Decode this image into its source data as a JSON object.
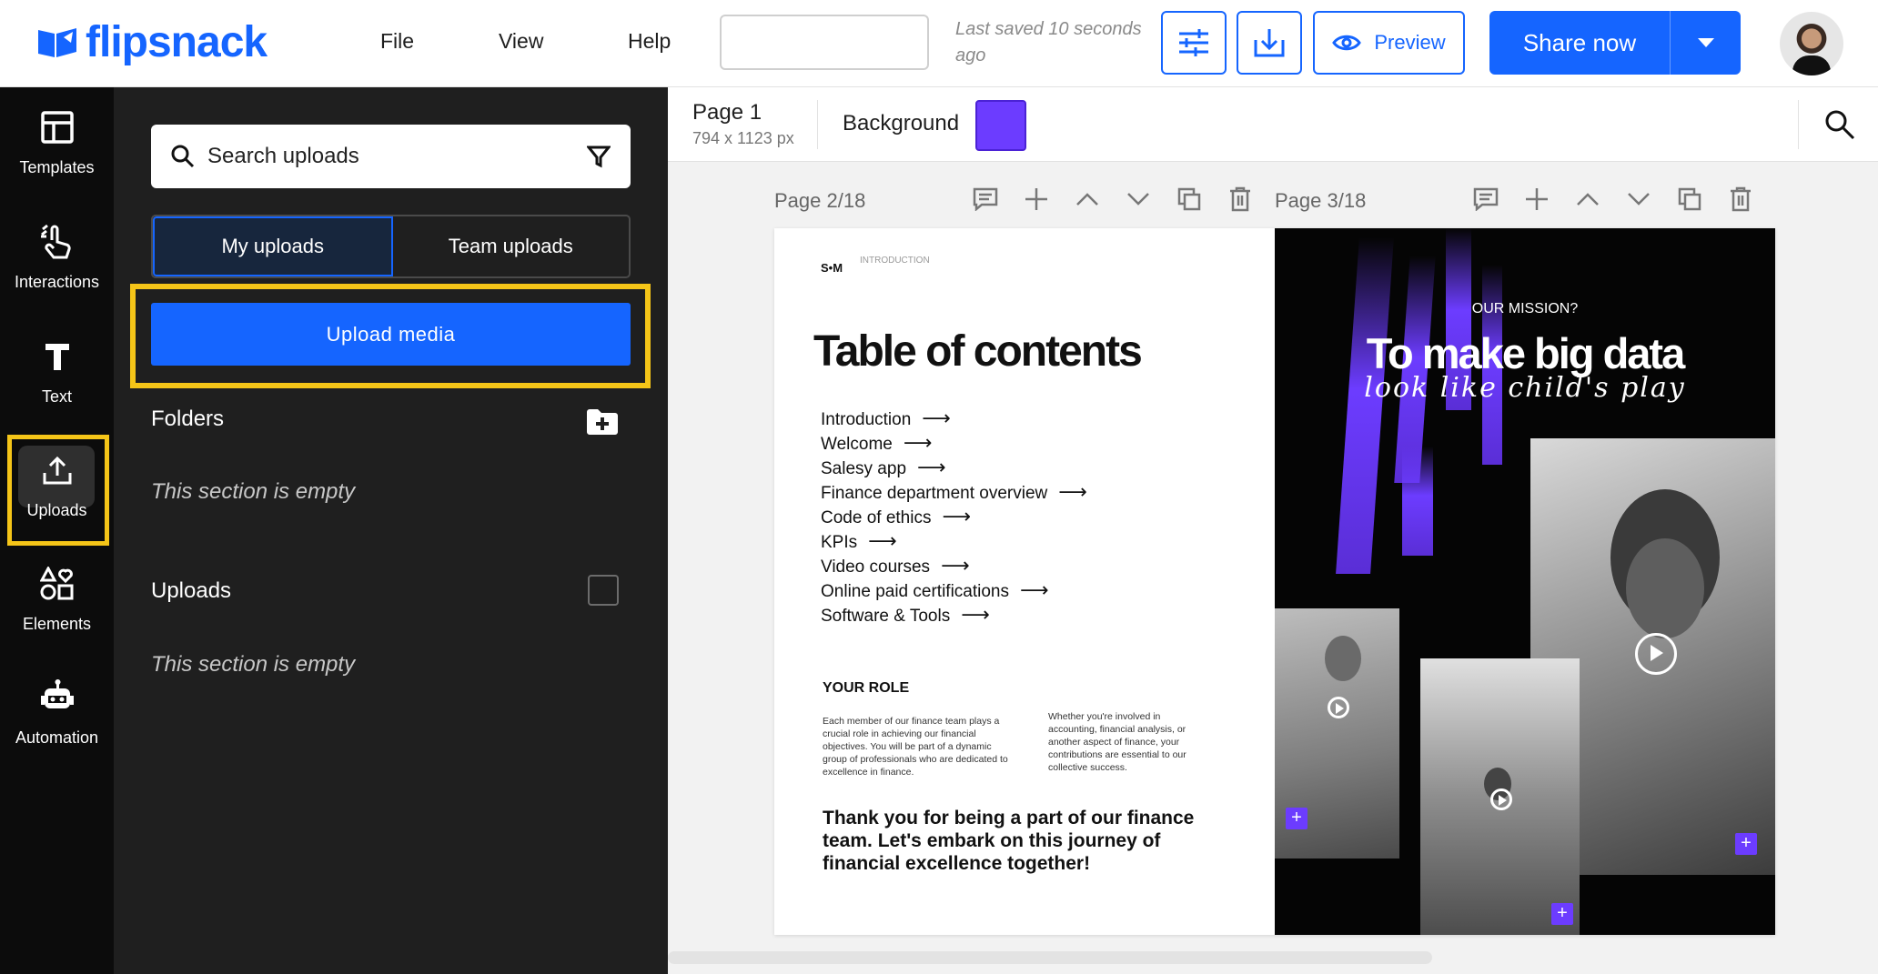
{
  "header": {
    "logo_text": "flipsnack",
    "menu": [
      "File",
      "View",
      "Help"
    ],
    "title_value": "",
    "saved_status": "Last saved 10 seconds ago",
    "preview_label": "Preview",
    "share_label": "Share now",
    "icons": [
      "settings-sliders-icon",
      "download-icon",
      "eye-icon",
      "chevron-down-icon"
    ]
  },
  "rail": {
    "items": [
      {
        "label": "Templates",
        "icon": "templates-icon"
      },
      {
        "label": "Interactions",
        "icon": "interactions-icon"
      },
      {
        "label": "Text",
        "icon": "text-icon"
      },
      {
        "label": "Uploads",
        "icon": "upload-icon"
      },
      {
        "label": "Elements",
        "icon": "elements-icon"
      },
      {
        "label": "Automation",
        "icon": "robot-icon"
      }
    ],
    "active": "Uploads",
    "highlight_color": "#f5c518"
  },
  "panel": {
    "search_placeholder": "Search uploads",
    "tabs": [
      {
        "label": "My uploads",
        "active": true
      },
      {
        "label": "Team uploads",
        "active": false
      }
    ],
    "upload_button": "Upload media",
    "folders_title": "Folders",
    "folders_empty": "This section is empty",
    "uploads_title": "Uploads",
    "uploads_empty": "This section is empty"
  },
  "pagebar": {
    "page_name": "Page 1",
    "page_size": "794 x 1123 px",
    "background_label": "Background",
    "background_color": "#6c3cff"
  },
  "canvas": {
    "left_page_label": "Page 2/18",
    "right_page_label": "Page 3/18",
    "page_tools": [
      "comment-icon",
      "add-page-icon",
      "move-up-icon",
      "move-down-icon",
      "duplicate-icon",
      "delete-icon"
    ],
    "left_page": {
      "brand": "S•M",
      "brand_sub": "INTRODUCTION",
      "title": "Table of contents",
      "toc": [
        "Introduction",
        "Welcome",
        "Salesy app",
        "Finance department overview",
        "Code of ethics",
        "KPIs",
        "Video courses",
        "Online paid certifications",
        "Software & Tools"
      ],
      "arrow": "⟶",
      "role_title": "YOUR ROLE",
      "role_left": "Each member of our finance team plays a crucial role in achieving our financial objectives. You will be part of a dynamic group of professionals who are dedicated to excellence in finance.",
      "role_right": "Whether you're involved in accounting, financial analysis, or another aspect of finance, your contributions are essential to our collective success.",
      "thanks": "Thank you for being a part of our finance team. Let's embark on this journey of financial excellence together!"
    },
    "right_page": {
      "kicker": "OUR MISSION?",
      "headline": "To make big data",
      "script": "look like child's play",
      "accent": "#6c3cff"
    }
  }
}
